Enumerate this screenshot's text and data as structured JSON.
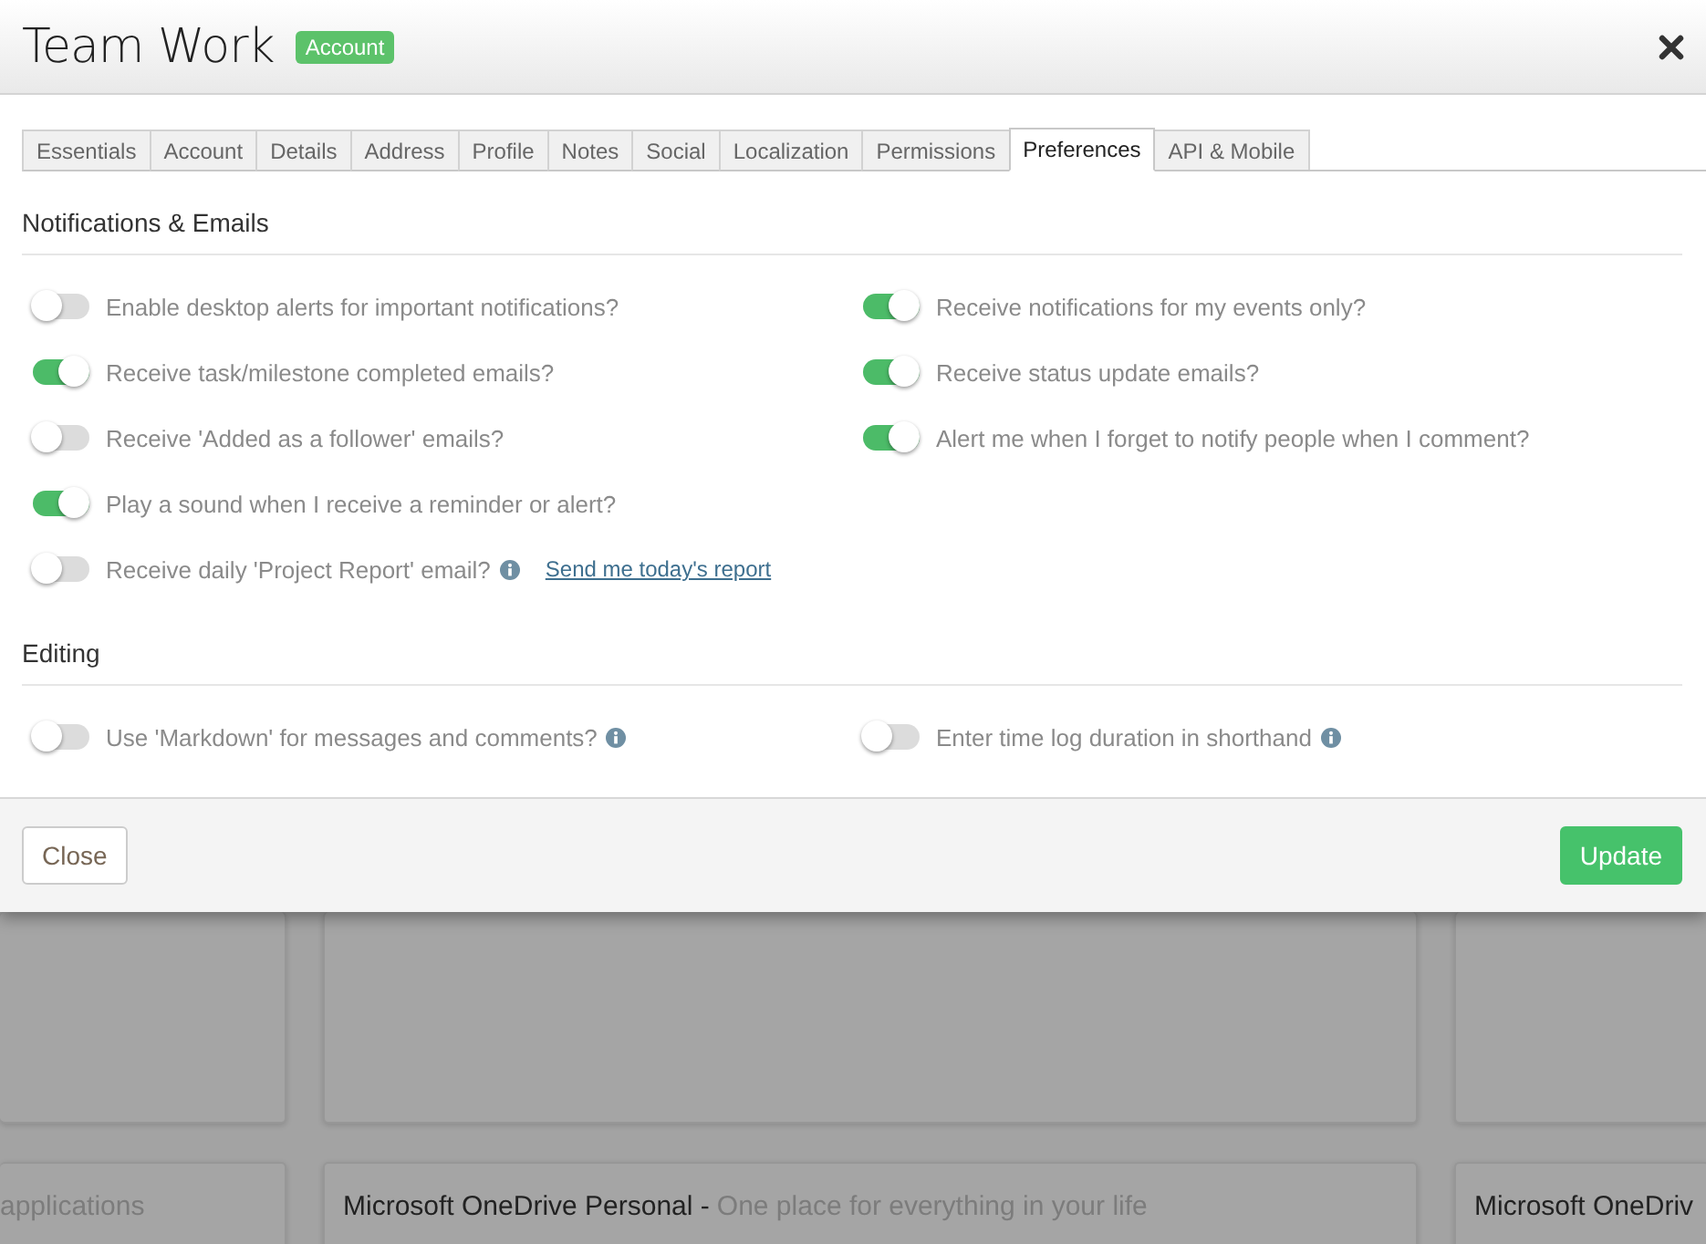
{
  "dialog": {
    "title": "Team Work",
    "badge": "Account"
  },
  "tabs": [
    {
      "label": "Essentials",
      "selected": false
    },
    {
      "label": "Account",
      "selected": false
    },
    {
      "label": "Details",
      "selected": false
    },
    {
      "label": "Address",
      "selected": false
    },
    {
      "label": "Profile",
      "selected": false
    },
    {
      "label": "Notes",
      "selected": false
    },
    {
      "label": "Social",
      "selected": false
    },
    {
      "label": "Localization",
      "selected": false
    },
    {
      "label": "Permissions",
      "selected": false
    },
    {
      "label": "Preferences",
      "selected": true
    },
    {
      "label": "API & Mobile",
      "selected": false
    }
  ],
  "sections": [
    {
      "heading": "Notifications & Emails",
      "columns": [
        [
          {
            "label": "Enable desktop alerts for important notifications?",
            "on": false
          },
          {
            "label": "Receive task/milestone completed emails?",
            "on": true
          },
          {
            "label": "Receive 'Added as a follower' emails?",
            "on": false
          },
          {
            "label": "Play a sound when I receive a reminder or alert?",
            "on": true
          },
          {
            "label": "Receive daily 'Project Report' email?",
            "on": false,
            "info": true,
            "link": "Send me today's report"
          }
        ],
        [
          {
            "label": "Receive notifications for my events only?",
            "on": true
          },
          {
            "label": "Receive status update emails?",
            "on": true
          },
          {
            "label": "Alert me when I forget to notify people when I comment?",
            "on": true
          }
        ]
      ]
    },
    {
      "heading": "Editing",
      "columns": [
        [
          {
            "label": "Use 'Markdown' for messages and comments?",
            "on": false,
            "info": true
          }
        ],
        [
          {
            "label": "Enter time log duration in shorthand",
            "on": false,
            "info": true
          }
        ]
      ]
    }
  ],
  "footer_buttons": [
    {
      "label": "Close",
      "kind": "secondary"
    },
    {
      "label": "Update",
      "kind": "primary"
    }
  ],
  "background_cards": [
    {
      "description": "applications"
    },
    {
      "title": "Microsoft OneDrive Personal -",
      "description": "One place for everything in your life"
    },
    {
      "title": "Microsoft OneDriv"
    }
  ]
}
